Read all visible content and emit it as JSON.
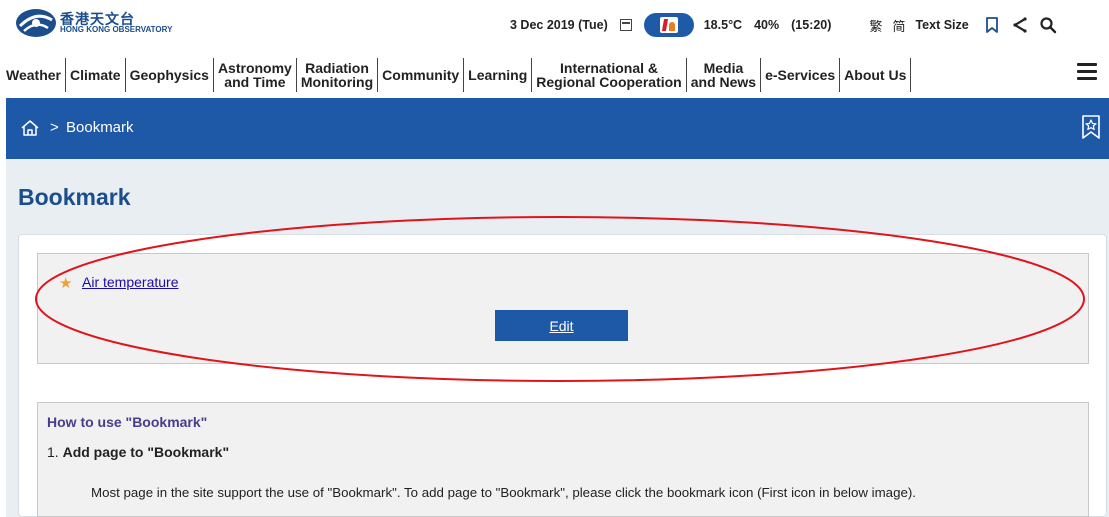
{
  "logo": {
    "cn": "香港天文台",
    "en": "HONG KONG OBSERVATORY"
  },
  "status": {
    "date": "3 Dec 2019 (Tue)",
    "temperature": "18.5°C",
    "humidity": "40%",
    "time": "(15:20)",
    "lang_trad": "繁",
    "lang_simp": "简",
    "text_size": "Text Size"
  },
  "nav": {
    "items": [
      {
        "label": "Weather"
      },
      {
        "label": "Climate"
      },
      {
        "label": "Geophysics"
      },
      {
        "label1": "Astronomy",
        "label2": "and Time"
      },
      {
        "label1": "Radiation",
        "label2": "Monitoring"
      },
      {
        "label": "Community"
      },
      {
        "label": "Learning"
      },
      {
        "label1": "International &",
        "label2": "Regional Cooperation"
      },
      {
        "label1": "Media",
        "label2": "and News"
      },
      {
        "label": "e-Services"
      },
      {
        "label": "About Us"
      }
    ]
  },
  "breadcrumb": {
    "separator": ">",
    "current": "Bookmark"
  },
  "page": {
    "title": "Bookmark"
  },
  "bookmarks": {
    "items": [
      {
        "label": "Air temperature"
      }
    ],
    "edit_label": "Edit"
  },
  "howto": {
    "title": "How to use \"Bookmark\"",
    "step_number": "1.",
    "step_title": "Add page to \"Bookmark\"",
    "desc": "Most page in the site support the use of \"Bookmark\". To add page to \"Bookmark\", please click the bookmark icon (First icon in below image)."
  },
  "colors": {
    "brand_blue": "#1d59a7",
    "annotation_red": "#e0141b",
    "star": "#f0a132"
  }
}
